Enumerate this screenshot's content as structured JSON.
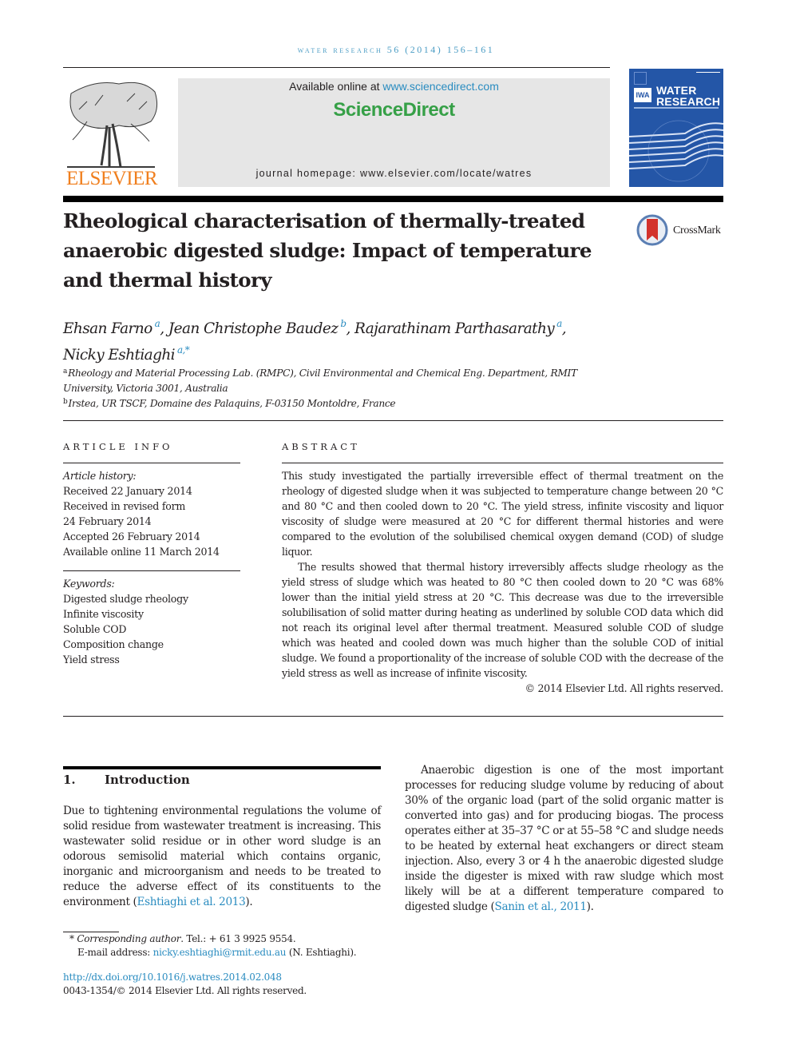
{
  "running_header": "water research 56 (2014) 156–161",
  "masthead": {
    "publisher": "ELSEVIER",
    "available_prefix": "Available online at ",
    "available_link": "www.sciencedirect.com",
    "brand": "ScienceDirect",
    "homepage": "journal homepage: www.elsevier.com/locate/watres",
    "cover": {
      "badge": "IWA",
      "title_line1": "WATER",
      "title_line2": "RESEARCH",
      "colors": {
        "background": "#2456a7"
      }
    },
    "colors": {
      "publisher": "#f07f1e",
      "brand": "#36a047",
      "link": "#2a8cc0",
      "box": "#e6e6e6"
    }
  },
  "article": {
    "title": "Rheological characterisation of thermally-treated anaerobic digested sludge: Impact of temperature and thermal history",
    "crossmark_label": "CrossMark",
    "authors": [
      {
        "name": "Ehsan Farno",
        "sup": "a",
        "sep": ", "
      },
      {
        "name": "Jean Christophe Baudez",
        "sup": "b",
        "sep": ", "
      },
      {
        "name": "Rajarathinam Parthasarathy",
        "sup": "a",
        "sep": ","
      },
      {
        "name": "Nicky Eshtiaghi",
        "sup": "a,*",
        "sep": ""
      }
    ],
    "affiliations": [
      {
        "mark": "a",
        "text": "Rheology and Material Processing Lab. (RMPC), Civil Environmental and Chemical Eng. Department, RMIT University, Victoria 3001, Australia"
      },
      {
        "mark": "b",
        "text": "Irstea, UR TSCF, Domaine des Palaquins, F-03150 Montoldre, France"
      }
    ]
  },
  "article_info": {
    "heading": "ARTICLE INFO",
    "history_label": "Article history:",
    "history": [
      "Received 22 January 2014",
      "Received in revised form",
      "24 February 2014",
      "Accepted 26 February 2014",
      "Available online 11 March 2014"
    ],
    "keywords_label": "Keywords:",
    "keywords": [
      "Digested sludge rheology",
      "Infinite viscosity",
      "Soluble COD",
      "Composition change",
      "Yield stress"
    ]
  },
  "abstract": {
    "heading": "ABSTRACT",
    "paragraphs": [
      "This study investigated the partially irreversible effect of thermal treatment on the rheology of digested sludge when it was subjected to temperature change between 20 °C and 80 °C and then cooled down to 20 °C. The yield stress, infinite viscosity and liquor viscosity of sludge were measured at 20 °C for different thermal histories and were compared to the evolution of the solubilised chemical oxygen demand (COD) of sludge liquor.",
      "The results showed that thermal history irreversibly affects sludge rheology as the yield stress of sludge which was heated to 80 °C then cooled down to 20 °C was 68% lower than the initial yield stress at 20 °C. This decrease was due to the irreversible solubilisation of solid matter during heating as underlined by soluble COD data which did not reach its original level after thermal treatment. Measured soluble COD of sludge which was heated and cooled down was much higher than the soluble COD of initial sludge. We found a proportionality of the increase of soluble COD with the decrease of the yield stress as well as increase of infinite viscosity."
    ],
    "copyright": "© 2014 Elsevier Ltd. All rights reserved."
  },
  "introduction": {
    "number": "1.",
    "heading": "Introduction",
    "left_para_text": "Due to tightening environmental regulations the volume of solid residue from wastewater treatment is increasing. This wastewater solid residue or in other word sludge is an odorous semisolid material which contains organic, inorganic and microorganism and needs to be treated to reduce the adverse effect of its constituents to the environment (",
    "left_para_cite": "Eshtiaghi et al. 2013",
    "left_para_end": ").",
    "right_para_text": "Anaerobic digestion is one of the most important processes for reducing sludge volume by reducing of about 30% of the organic load (part of the solid organic matter is converted into gas) and for producing biogas. The process operates either at 35–37 °C or at 55–58 °C and sludge needs to be heated by external heat exchangers or direct steam injection. Also, every 3 or 4 h the anaerobic digested sludge inside the digester is mixed with raw sludge which most likely will be at a different temperature compared to digested sludge (",
    "right_para_cite": "Sanin et al., 2011",
    "right_para_end": ")."
  },
  "footnotes": {
    "star": "*",
    "corresponding_label": "Corresponding author",
    "tel": ". Tel.: + 61 3 9925 9554.",
    "email_label": "E-mail address: ",
    "email": "nicky.eshtiaghi@rmit.edu.au",
    "email_suffix": " (N. Eshtiaghi).",
    "doi": "http://dx.doi.org/10.1016/j.watres.2014.02.048",
    "issn": "0043-1354/© 2014 Elsevier Ltd. All rights reserved."
  }
}
